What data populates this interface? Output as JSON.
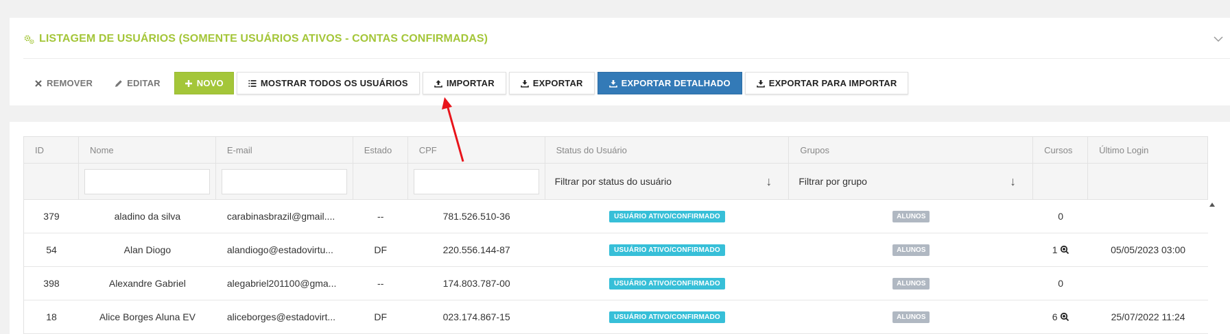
{
  "header": {
    "title": "LISTAGEM DE USUÁRIOS (SOMENTE USUÁRIOS ATIVOS - CONTAS CONFIRMADAS)",
    "title_color": "#a4c639",
    "title_icon": "gears-icon",
    "collapse_icon": "chevron-down-icon"
  },
  "toolbar": {
    "remover": "REMOVER",
    "editar": "EDITAR",
    "novo": "NOVO",
    "mostrar_todos": "MOSTRAR TODOS OS USUÁRIOS",
    "importar": "IMPORTAR",
    "exportar": "EXPORTAR",
    "exportar_detalhado": "EXPORTAR DETALHADO",
    "exportar_para_importar": "EXPORTAR PARA IMPORTAR",
    "green": "#a4c639",
    "blue": "#337ab7"
  },
  "table": {
    "columns": [
      "ID",
      "Nome",
      "E-mail",
      "Estado",
      "CPF",
      "Status do Usuário",
      "Grupos",
      "Cursos",
      "Último Login"
    ],
    "filters": {
      "status_placeholder": "Filtrar por status do usuário",
      "group_placeholder": "Filtrar por grupo"
    },
    "rows": [
      {
        "id": "379",
        "nome": "aladino da silva",
        "email": "carabinasbrazil@gmail....",
        "estado": "--",
        "cpf": "781.526.510-36",
        "status": "USUÁRIO ATIVO/CONFIRMADO",
        "grupo": "ALUNOS",
        "cursos": "0",
        "login": ""
      },
      {
        "id": "54",
        "nome": "Alan Diogo",
        "email": "alandiogo@estadovirtu...",
        "estado": "DF",
        "cpf": "220.556.144-87",
        "status": "USUÁRIO ATIVO/CONFIRMADO",
        "grupo": "ALUNOS",
        "cursos": "1",
        "login": "05/05/2023 03:00"
      },
      {
        "id": "398",
        "nome": "Alexandre Gabriel",
        "email": "alegabriel201100@gma...",
        "estado": "--",
        "cpf": "174.803.787-00",
        "status": "USUÁRIO ATIVO/CONFIRMADO",
        "grupo": "ALUNOS",
        "cursos": "0",
        "login": ""
      },
      {
        "id": "18",
        "nome": "Alice Borges Aluna EV",
        "email": "aliceborges@estadovirt...",
        "estado": "DF",
        "cpf": "023.174.867-15",
        "status": "USUÁRIO ATIVO/CONFIRMADO",
        "grupo": "ALUNOS",
        "cursos": "6",
        "login": "25/07/2022 11:24"
      }
    ],
    "status_color": "#37bfd8",
    "group_color": "#b0b8c2"
  },
  "annotation": {
    "arrow_color": "#e8141b"
  }
}
